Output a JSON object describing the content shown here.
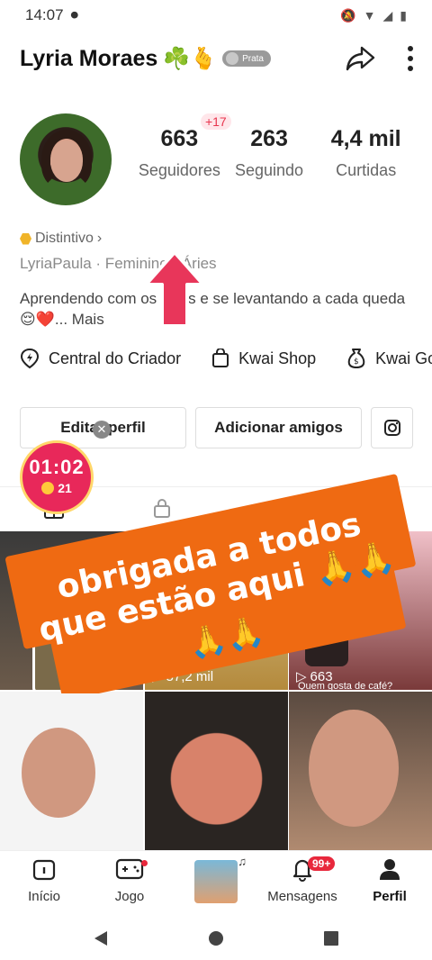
{
  "status_bar": {
    "time": "14:07"
  },
  "profile": {
    "name": "Lyria Moraes",
    "name_emoji": "☘️🫰",
    "rank_badge": "Prata",
    "stats": [
      {
        "value": "663",
        "label": "Seguidores",
        "new": "+17"
      },
      {
        "value": "263",
        "label": "Seguindo"
      },
      {
        "value": "4,4 mil",
        "label": "Curtidas"
      }
    ],
    "distintivo": "Distintivo",
    "meta_line": "LyriaPaula · Feminino · Áries",
    "bio": "Aprendendo com os erros e se levantando a cada queda 😌❤️...",
    "bio_more": "Mais"
  },
  "shortcuts": [
    {
      "label": "Central do Criador",
      "icon": "bolt-pin-icon"
    },
    {
      "label": "Kwai Shop",
      "icon": "shopping-bag-icon"
    },
    {
      "label": "Kwai Gold",
      "icon": "money-bag-icon"
    }
  ],
  "buttons": {
    "edit": "Editar perfil",
    "add_friends": "Adicionar amigos"
  },
  "timer": {
    "time": "01:02",
    "coins": "21"
  },
  "banner": {
    "line1": "obrigada a todos",
    "line2": "que estão aqui 🙏🙏",
    "line3": "🙏🙏"
  },
  "grid": [
    {
      "label": "",
      "views": ""
    },
    {
      "label": "",
      "views": "57,2 mil"
    },
    {
      "label": "",
      "views": "663",
      "caption": "Quem gosta de café?"
    },
    {
      "label": "",
      "views": ""
    },
    {
      "label": "",
      "views": ""
    },
    {
      "label": "",
      "views": ""
    }
  ],
  "bottom_nav": [
    {
      "label": "Início"
    },
    {
      "label": "Jogo"
    },
    {
      "label": ""
    },
    {
      "label": "Mensagens",
      "badge": "99+"
    },
    {
      "label": "Perfil"
    }
  ]
}
